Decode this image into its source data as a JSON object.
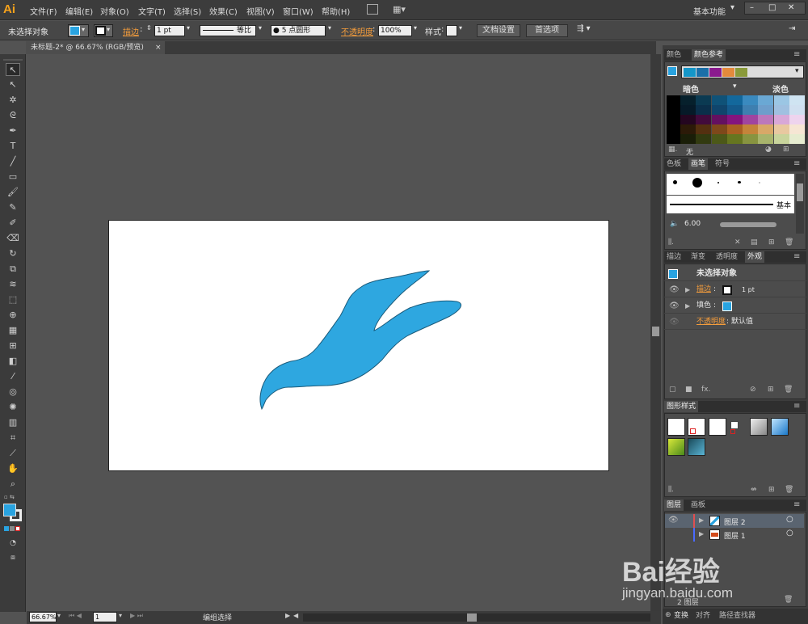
{
  "app": {
    "logo": "Ai",
    "workspace": "基本功能",
    "window_controls": [
      "–",
      "□",
      "✕"
    ]
  },
  "menu": [
    "文件(F)",
    "编辑(E)",
    "对象(O)",
    "文字(T)",
    "选择(S)",
    "效果(C)",
    "视图(V)",
    "窗口(W)",
    "帮助(H)"
  ],
  "control_bar": {
    "selection": "未选择对象",
    "stroke_label": "描边",
    "stroke_width": "1 pt",
    "profile": "等比",
    "brush": "5 点圆形",
    "opacity_label": "不透明度",
    "opacity_value": "100%",
    "style_label": "样式",
    "doc_setup": "文档设置",
    "preferences": "首选项",
    "fill_color": "#29a3e0"
  },
  "document": {
    "tab": "未标题-2* @ 66.67% (RGB/预览)",
    "close": "×"
  },
  "artwork": {
    "fill": "#2ea7e0",
    "stroke": "#1a5a7a"
  },
  "status": {
    "zoom": "66.67%",
    "page": "1",
    "mode": "编组选择"
  },
  "color_panel": {
    "tabs": [
      "颜色",
      "颜色参考"
    ],
    "dark_label": "暗色",
    "light_label": "淡色",
    "none_label": "无",
    "harmony": [
      "#1496c8",
      "#1b6fa8",
      "#8a1a8e",
      "#e48a3c",
      "#8a9a3a"
    ],
    "grid": [
      [
        "#000000",
        "#06202c",
        "#0b3a52",
        "#0f5278",
        "#13689c",
        "#3a8abf",
        "#6aa8d4",
        "#9bc6e4",
        "#cfe4f2"
      ],
      [
        "#000000",
        "#061a28",
        "#0b2f4a",
        "#10456c",
        "#145a8c",
        "#3e7fb0",
        "#6e9ecb",
        "#a0c0e0",
        "#d0e0f0"
      ],
      [
        "#000000",
        "#240620",
        "#420b3c",
        "#641060",
        "#84147e",
        "#a044a0",
        "#bc78bc",
        "#d8a8d8",
        "#eed4ee"
      ],
      [
        "#000000",
        "#2c1a08",
        "#543010",
        "#7e481a",
        "#a86022",
        "#c4843a",
        "#d8a868",
        "#e8c8a0",
        "#f6e6d4"
      ],
      [
        "#000000",
        "#1a1e08",
        "#323a10",
        "#4c5818",
        "#667620",
        "#889440",
        "#a8b46c",
        "#c8d49c",
        "#e6ecd0"
      ]
    ]
  },
  "brushes_panel": {
    "tabs": [
      "色板",
      "画笔",
      "符号"
    ],
    "basic_label": "基本",
    "size_value": "6.00"
  },
  "appearance_panel": {
    "tabs": [
      "描边",
      "渐变",
      "透明度",
      "外观"
    ],
    "title": "未选择对象",
    "stroke_label": "描边",
    "stroke_value": "1 pt",
    "fill_label": "填色",
    "opacity_label": "不透明度",
    "opacity_value": "默认值"
  },
  "graphic_styles_panel": {
    "tab": "图形样式"
  },
  "layers_panel": {
    "tabs": [
      "图层",
      "画板"
    ],
    "layers": [
      {
        "name": "图层 2",
        "color": "#e05050"
      },
      {
        "name": "图层 1",
        "color": "#4a6aff"
      }
    ],
    "footer": "2 图层"
  },
  "bottom_dock": {
    "tabs": [
      "变换",
      "对齐",
      "路径查找器"
    ]
  },
  "watermark": {
    "brand": "Bai经验",
    "url": "jingyan.baidu.com"
  }
}
